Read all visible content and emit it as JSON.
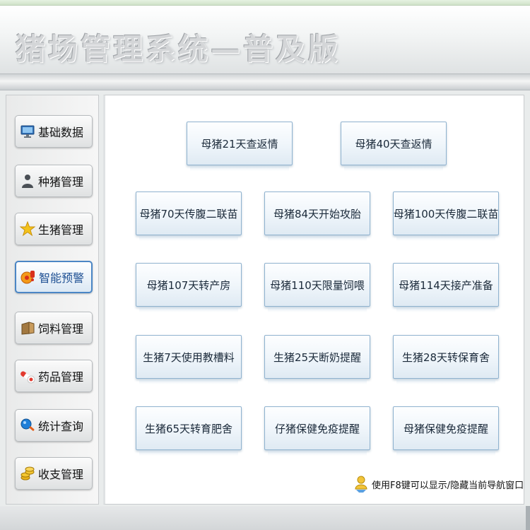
{
  "app": {
    "title": "猪场管理系统—普及版"
  },
  "sidebar": {
    "items": [
      {
        "label": "基础数据",
        "icon": "monitor-icon",
        "active": false
      },
      {
        "label": "种猪管理",
        "icon": "person-icon",
        "active": false
      },
      {
        "label": "生猪管理",
        "icon": "star-icon",
        "active": false
      },
      {
        "label": "智能预警",
        "icon": "warning-icon",
        "active": true
      },
      {
        "label": "饲料管理",
        "icon": "feed-box-icon",
        "active": false
      },
      {
        "label": "药品管理",
        "icon": "pills-icon",
        "active": false
      },
      {
        "label": "统计查询",
        "icon": "query-icon",
        "active": false
      },
      {
        "label": "收支管理",
        "icon": "coins-icon",
        "active": false
      }
    ]
  },
  "main": {
    "buttons": [
      "母猪21天查返情",
      "母猪40天查返情",
      "母猪70天传腹二联苗",
      "母猪84天开始攻胎",
      "母猪100天传腹二联苗",
      "母猪107天转产房",
      "母猪110天限量饲喂",
      "母猪114天接产准备",
      "生猪7天使用教槽料",
      "生猪25天断奶提醒",
      "生猪28天转保育舍",
      "生猪65天转育肥舍",
      "仔猪保健免疫提醒",
      "母猪保健免疫提醒"
    ]
  },
  "hint": {
    "text": "使用F8键可以显示/隐藏当前导航窗口",
    "icon": "user-hint-icon"
  },
  "colors": {
    "accent": "#4b86c5",
    "button_border": "#8fb2cf",
    "title_gray": "#d4d6d8"
  }
}
